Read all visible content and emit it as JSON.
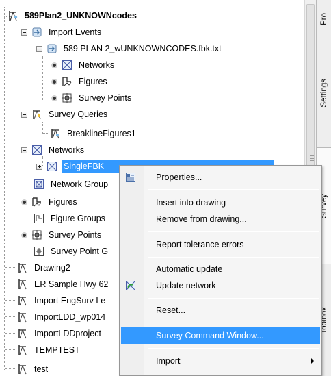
{
  "tree": {
    "project": "589Plan2_UNKNOWNcodes",
    "import_events": "Import Events",
    "import_file": "589 PLAN 2_wUNKNOWNCODES.fbk.txt",
    "file_networks": "Networks",
    "file_figures": "Figures",
    "file_survey_points": "Survey Points",
    "survey_queries": "Survey Queries",
    "breakline_figures": "BreaklineFigures1",
    "networks": "Networks",
    "single_fbk": "SingleFBK",
    "network_groups": "Network Group",
    "figures": "Figures",
    "figure_groups": "Figure Groups",
    "survey_points": "Survey Points",
    "survey_point_groups": "Survey Point G",
    "drawing2": "Drawing2",
    "er_sample": "ER Sample Hwy 62",
    "import_engsurv": "Import EngSurv Le",
    "importldd_wp": "ImportLDD_wp014",
    "importldd_project": "ImportLDDproject",
    "temptest": "TEMPTEST",
    "test": "test"
  },
  "palette_tabs": [
    "Pro",
    "Settings",
    "Survey",
    "Toolbox"
  ],
  "context_menu": {
    "properties": "Properties...",
    "insert": "Insert into drawing",
    "remove": "Remove from drawing...",
    "report": "Report tolerance errors",
    "auto_update": "Automatic update",
    "update_network": "Update network",
    "reset": "Reset...",
    "survey_command_window": "Survey Command Window...",
    "import": "Import"
  },
  "colors": {
    "selection": "#3399ff",
    "menu_background": "#f5f5f5"
  }
}
